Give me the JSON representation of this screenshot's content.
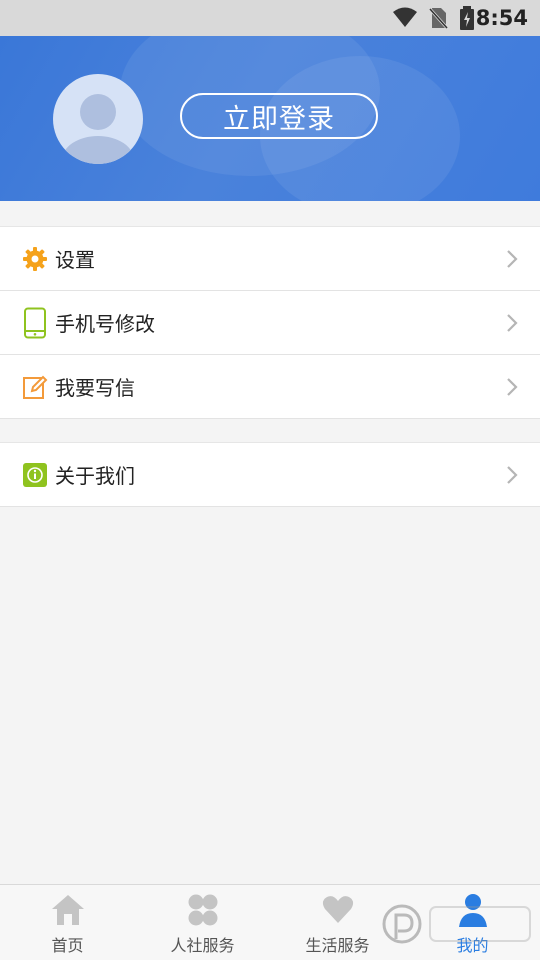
{
  "status_bar": {
    "time": "8:54"
  },
  "header": {
    "login_label": "立即登录"
  },
  "menu_group_1": [
    {
      "label": "设置",
      "icon": "gear-icon"
    },
    {
      "label": "手机号修改",
      "icon": "phone-icon"
    },
    {
      "label": "我要写信",
      "icon": "edit-icon"
    }
  ],
  "menu_group_2": [
    {
      "label": "关于我们",
      "icon": "info-icon"
    }
  ],
  "tabs": [
    {
      "label": "首页",
      "icon": "home-icon"
    },
    {
      "label": "人社服务",
      "icon": "clover-icon"
    },
    {
      "label": "生活服务",
      "icon": "heart-icon"
    },
    {
      "label": "我的",
      "icon": "user-icon",
      "active": true
    }
  ],
  "colors": {
    "banner": "#3a77d8",
    "accent": "#2a7de1",
    "gear": "#f5a21b",
    "phone": "#8fc31f",
    "edit": "#f39a3a",
    "info": "#8fc31f"
  }
}
